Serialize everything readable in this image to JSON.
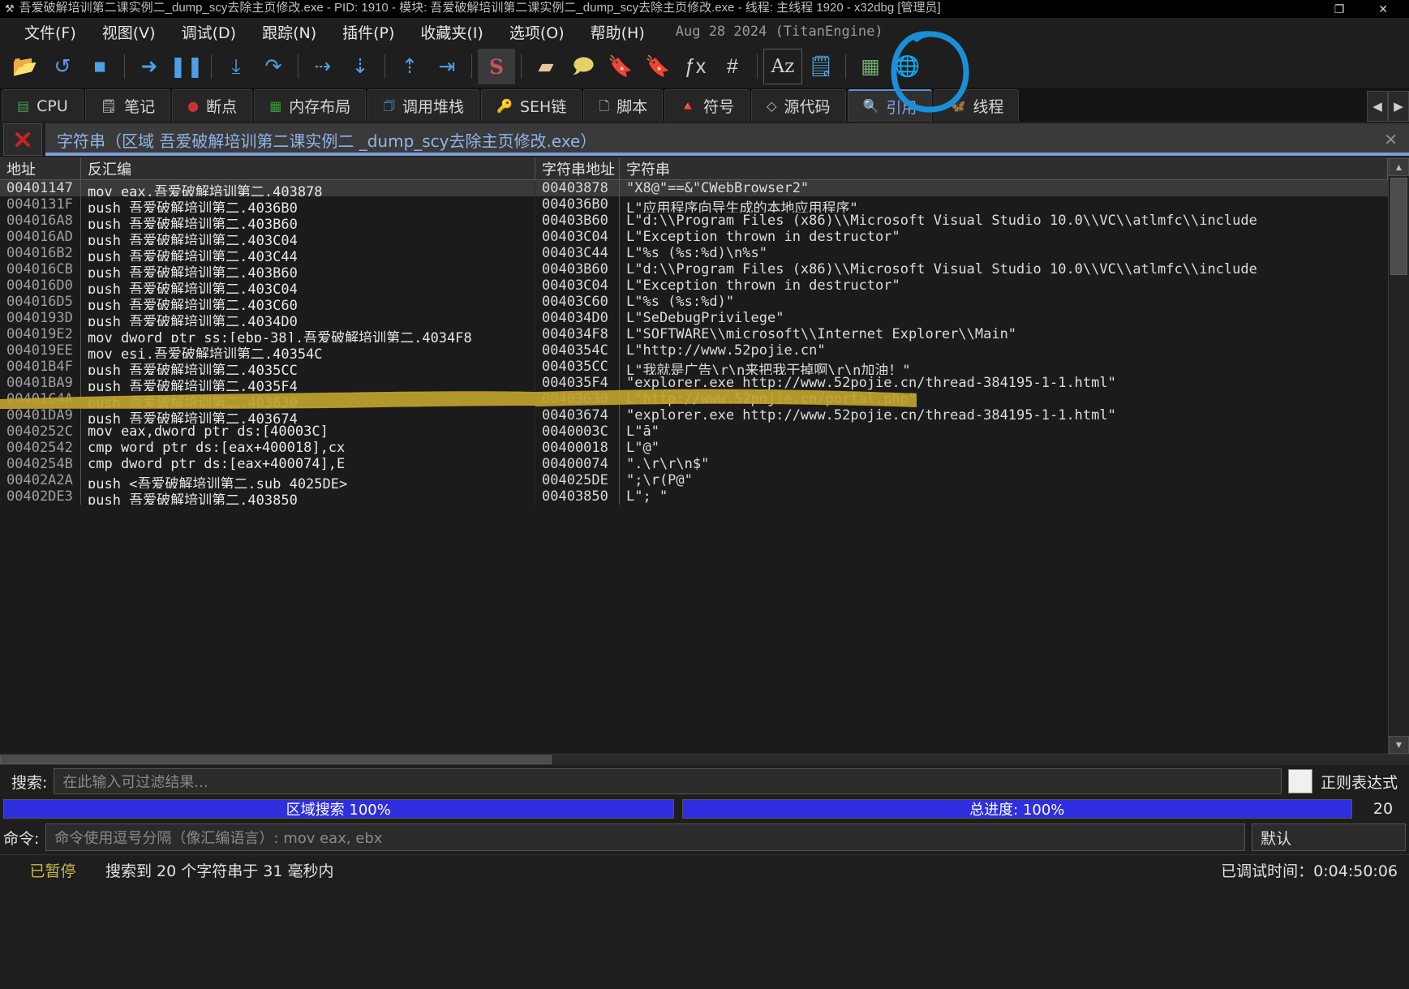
{
  "window": {
    "title": "吾爱破解培训第二课实例二_dump_scy去除主页修改.exe - PID: 1910 - 模块: 吾爱破解培训第二课实例二_dump_scy去除主页修改.exe - 线程: 主线程 1920 - x32dbg [管理员]",
    "app_icon": "x-icon",
    "restore_label": "❐",
    "close_label": "✕"
  },
  "menu": {
    "items": [
      {
        "label": "文件(F)",
        "name": "menu-file"
      },
      {
        "label": "视图(V)",
        "name": "menu-view"
      },
      {
        "label": "调试(D)",
        "name": "menu-debug"
      },
      {
        "label": "跟踪(N)",
        "name": "menu-trace"
      },
      {
        "label": "插件(P)",
        "name": "menu-plugins"
      },
      {
        "label": "收藏夹(I)",
        "name": "menu-favourites"
      },
      {
        "label": "选项(O)",
        "name": "menu-options"
      },
      {
        "label": "帮助(H)",
        "name": "menu-help"
      }
    ],
    "build_info": "Aug 28 2024 (TitanEngine)"
  },
  "toolbar": {
    "buttons": [
      {
        "name": "open-icon",
        "glyph": "📂",
        "color": "#e8bf6a"
      },
      {
        "name": "restart-icon",
        "glyph": "↺",
        "color": "#56a0e8"
      },
      {
        "name": "stop-icon",
        "glyph": "■",
        "color": "#4d9fe8"
      },
      {
        "sep": true
      },
      {
        "name": "run-icon",
        "glyph": "➜",
        "color": "#4d9fe8"
      },
      {
        "name": "pause-icon",
        "glyph": "❚❚",
        "color": "#4d9fe8"
      },
      {
        "sep": true
      },
      {
        "name": "step-into-icon",
        "glyph": "⤓",
        "color": "#4d9fe8"
      },
      {
        "name": "step-over-icon",
        "glyph": "↷",
        "color": "#4d9fe8"
      },
      {
        "sep": true
      },
      {
        "name": "run-to-return-icon",
        "glyph": "⇢",
        "color": "#4d9fe8"
      },
      {
        "name": "step-out-icon",
        "glyph": "⇣",
        "color": "#4d9fe8"
      },
      {
        "sep": true
      },
      {
        "name": "run-up-icon",
        "glyph": "⇡",
        "color": "#4d9fe8"
      },
      {
        "name": "run-to-user-icon",
        "glyph": "⇥",
        "color": "#4d9fe8"
      },
      {
        "sep": true
      },
      {
        "name": "scylla-icon",
        "glyph": "S",
        "color": "#c4555a"
      },
      {
        "sep": true
      },
      {
        "name": "patch-icon",
        "glyph": "▰",
        "color": "#e8c49a"
      },
      {
        "name": "comment-icon",
        "glyph": "🗩",
        "color": "#e2d16a"
      },
      {
        "name": "bookmark-blue-icon",
        "glyph": "🔖",
        "color": "#5fb0e8"
      },
      {
        "name": "bookmark-red-icon",
        "glyph": "🔖",
        "color": "#d44545"
      },
      {
        "name": "function-icon",
        "glyph": "ƒx",
        "color": "#d0d0d0"
      },
      {
        "name": "hash-icon",
        "glyph": "#",
        "color": "#d0d0d0"
      },
      {
        "sep": true
      },
      {
        "name": "string-references-icon",
        "glyph": "Az",
        "color": "#d0d0d0",
        "annotated": true
      },
      {
        "name": "export-icon",
        "glyph": "🗒",
        "color": "#5fb0e8"
      },
      {
        "sep": true
      },
      {
        "name": "calculator-icon",
        "glyph": "▦",
        "color": "#6fae6f"
      },
      {
        "name": "globe-icon",
        "glyph": "🌐",
        "color": "#4d9fe8"
      }
    ]
  },
  "tabs": [
    {
      "label": "CPU",
      "icon": "cpu-icon",
      "active": false
    },
    {
      "label": "笔记",
      "icon": "notes-icon",
      "active": false
    },
    {
      "label": "断点",
      "icon": "breakpoint-icon",
      "active": false
    },
    {
      "label": "内存布局",
      "icon": "memorymap-icon",
      "active": false
    },
    {
      "label": "调用堆栈",
      "icon": "callstack-icon",
      "active": false
    },
    {
      "label": "SEH链",
      "icon": "seh-icon",
      "active": false
    },
    {
      "label": "脚本",
      "icon": "script-icon",
      "active": false
    },
    {
      "label": "符号",
      "icon": "symbols-icon",
      "active": false
    },
    {
      "label": "源代码",
      "icon": "source-icon",
      "active": false
    },
    {
      "label": "引用",
      "icon": "references-icon",
      "active": true
    },
    {
      "label": "线程",
      "icon": "threads-icon",
      "active": false
    }
  ],
  "tab_nav": {
    "prev": "◀",
    "next": "▶"
  },
  "subtab": {
    "close_icon": "red-x-icon",
    "title": "字符串（区域 吾爱破解培训第二课实例二 _dump_scy去除主页修改.exe）",
    "close_label": "✕"
  },
  "table": {
    "columns": [
      {
        "label": "地址",
        "name": "column-address"
      },
      {
        "label": "反汇编",
        "name": "column-disassembly"
      },
      {
        "label": "字符串地址",
        "name": "column-string-address"
      },
      {
        "label": "字符串",
        "name": "column-string"
      }
    ],
    "rows": [
      {
        "address": "00401147",
        "disasm": "mov eax,吾爱破解培训第二.403878",
        "straddr": "00403878",
        "str": "\"X8@\"==&\"CWebBrowser2\"",
        "selected": true
      },
      {
        "address": "0040131F",
        "disasm": "push 吾爱破解培训第二.4036B0",
        "straddr": "004036B0",
        "str": "L\"应用程序向导生成的本地应用程序\""
      },
      {
        "address": "004016A8",
        "disasm": "push 吾爱破解培训第二.403B60",
        "straddr": "00403B60",
        "str": "L\"d:\\\\Program Files (x86)\\\\Microsoft Visual Studio 10.0\\\\VC\\\\atlmfc\\\\include"
      },
      {
        "address": "004016AD",
        "disasm": "push 吾爱破解培训第二.403C04",
        "straddr": "00403C04",
        "str": "L\"Exception thrown in destructor\""
      },
      {
        "address": "004016B2",
        "disasm": "push 吾爱破解培训第二.403C44",
        "straddr": "00403C44",
        "str": "L\"%s (%s:%d)\\n%s\""
      },
      {
        "address": "004016CB",
        "disasm": "push 吾爱破解培训第二.403B60",
        "straddr": "00403B60",
        "str": "L\"d:\\\\Program Files (x86)\\\\Microsoft Visual Studio 10.0\\\\VC\\\\atlmfc\\\\include"
      },
      {
        "address": "004016D0",
        "disasm": "push 吾爱破解培训第二.403C04",
        "straddr": "00403C04",
        "str": "L\"Exception thrown in destructor\""
      },
      {
        "address": "004016D5",
        "disasm": "push 吾爱破解培训第二.403C60",
        "straddr": "00403C60",
        "str": "L\"%s (%s:%d)\""
      },
      {
        "address": "0040193D",
        "disasm": "push 吾爱破解培训第二.4034D0",
        "straddr": "004034D0",
        "str": "L\"SeDebugPrivilege\""
      },
      {
        "address": "004019E2",
        "disasm": "mov dword ptr ss:[ebp-38],吾爱破解培训第二.4034F8",
        "straddr": "004034F8",
        "str": "L\"SOFTWARE\\\\microsoft\\\\Internet Explorer\\\\Main\""
      },
      {
        "address": "004019EE",
        "disasm": "mov esi,吾爱破解培训第二.40354C",
        "straddr": "0040354C",
        "str": "L\"http://www.52pojie.cn\""
      },
      {
        "address": "00401B4F",
        "disasm": "push 吾爱破解培训第二.4035CC",
        "straddr": "004035CC",
        "str": "L\"我就是广告\\r\\n来把我干掉啊\\r\\n加油！\""
      },
      {
        "address": "00401BA9",
        "disasm": "push 吾爱破解培训第二.4035F4",
        "straddr": "004035F4",
        "str": "\"explorer.exe http://www.52pojie.cn/thread-384195-1-1.html\""
      },
      {
        "address": "00401C4A",
        "disasm": "push 吾爱破解培训第二.403630",
        "straddr": "00403630",
        "str": "L\"http://www.52pojie.cn/portal.php\"",
        "highlighted": true
      },
      {
        "address": "00401DA9",
        "disasm": "push 吾爱破解培训第二.403674",
        "straddr": "00403674",
        "str": "\"explorer.exe http://www.52pojie.cn/thread-384195-1-1.html\""
      },
      {
        "address": "0040252C",
        "disasm": "mov eax,dword ptr ds:[40003C]",
        "straddr": "0040003C",
        "str": "L\"ā\""
      },
      {
        "address": "00402542",
        "disasm": "cmp word ptr ds:[eax+400018],cx",
        "straddr": "00400018",
        "str": "L\"@\""
      },
      {
        "address": "0040254B",
        "disasm": "cmp dword ptr ds:[eax+400074],E",
        "straddr": "00400074",
        "str": "\".\\r\\r\\n$\""
      },
      {
        "address": "00402A2A",
        "disasm": "push <吾爱破解培训第二.sub_4025DE>",
        "straddr": "004025DE",
        "str": "\";\\r(P@\""
      },
      {
        "address": "00402DE3",
        "disasm": "push 吾爱破解培训第二.403850",
        "straddr": "00403850",
        "str": "L\"; \""
      }
    ]
  },
  "search": {
    "label": "搜索:",
    "placeholder": "在此输入可过滤结果...",
    "value": "",
    "regex_label": "正则表达式",
    "regex_checked": false
  },
  "progress": {
    "left_label": "区域搜索  100%",
    "left_percent": 100,
    "right_label": "总进度: 100%",
    "right_percent": 100,
    "count": "20",
    "bar_color": "#2f2fe0"
  },
  "command": {
    "label": "命令:",
    "placeholder": "命令使用逗号分隔（像汇编语言）: mov eax, ebx",
    "value": "",
    "profile": "默认",
    "chevron": "▾"
  },
  "status": {
    "state": "已暂停",
    "message": "搜索到 20 个字符串于 31 毫秒内",
    "time_label": "已调试时间：",
    "time_value": "0:04:50:06"
  },
  "annotations": {
    "circle_color": "#1a8fd8",
    "highlight_color": "#bfa32e"
  },
  "scroll": {
    "up": "▲",
    "down": "▼"
  }
}
